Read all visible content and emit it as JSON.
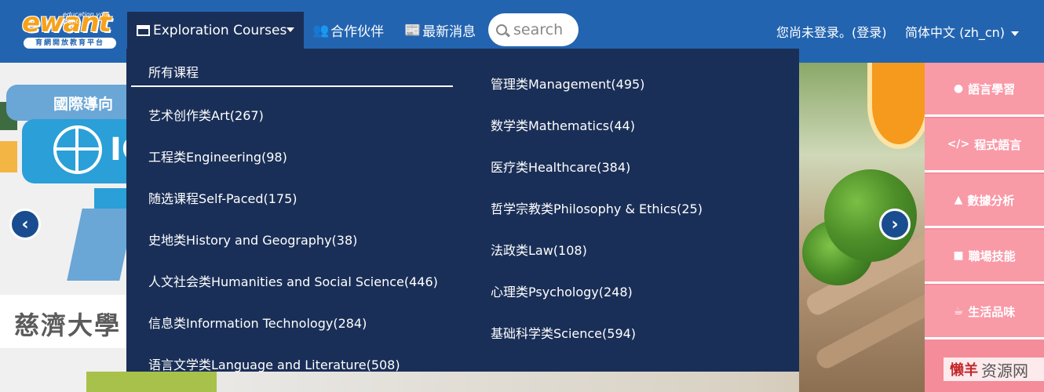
{
  "brand": {
    "logo_word": "ewant",
    "logo_tagline": "education you want!",
    "logo_subtitle": "育網開放教育平台"
  },
  "nav": {
    "courses_label": "Exploration Courses",
    "partners_label": "合作伙伴",
    "news_label": "最新消息",
    "search_placeholder": "search",
    "login_text": "您尚未登录。(登录)",
    "language_label": "简体中文 (zh_cn)"
  },
  "dropdown": {
    "header": "所有课程",
    "left_items": [
      "艺术创作类Art(267)",
      "工程类Engineering(98)",
      "随选课程Self-Paced(175)",
      "史地类History and Geography(38)",
      "人文社会类Humanities and Social Science(446)",
      "信息类Information Technology(284)",
      "语言文学类Language and Literature(508)"
    ],
    "right_items": [
      "管理类Management(495)",
      "数学类Mathematics(44)",
      "医疗类Healthcare(384)",
      "哲学宗教类Philosophy & Ethics(25)",
      "法政类Law(108)",
      "心理类Psychology(248)",
      "基础科学类Science(594)"
    ]
  },
  "banner": {
    "left_badge_text": "國際導向",
    "left_title_fragment": "IC",
    "left_caption": "慈濟大學"
  },
  "sidebar": {
    "items": [
      {
        "label": "語言學習",
        "icon": "globe-icon",
        "glyph": "●"
      },
      {
        "label": "程式語言",
        "icon": "code-icon",
        "glyph": "</>"
      },
      {
        "label": "數據分析",
        "icon": "chart-icon",
        "glyph": "▲"
      },
      {
        "label": "職場技能",
        "icon": "briefcase-icon",
        "glyph": "■"
      },
      {
        "label": "生活品味",
        "icon": "coffee-icon",
        "glyph": "☕"
      }
    ]
  },
  "carousel": {
    "prev_glyph": "‹",
    "next_glyph": "›"
  },
  "watermark": {
    "red_text": "懒羊",
    "gray_text": "资源网"
  },
  "colors": {
    "navbar": "#2364b0",
    "dropdown": "#1a2f57",
    "sidebar": "#f99aa7",
    "logo_orange": "#f6a21c"
  }
}
